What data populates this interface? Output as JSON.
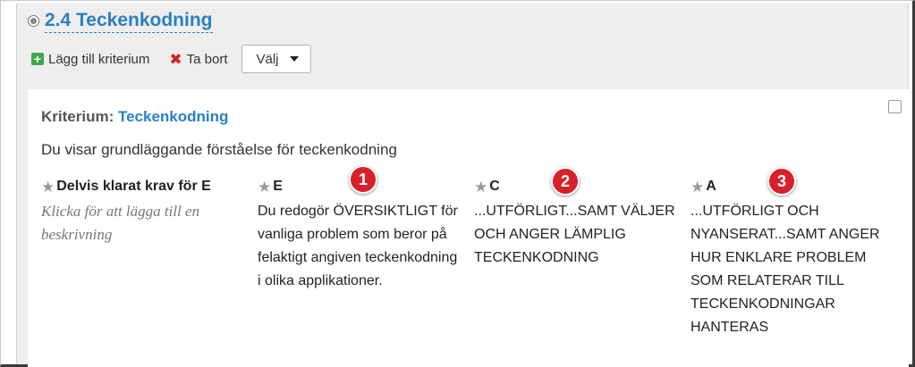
{
  "section": {
    "title": "2.4 Teckenkodning"
  },
  "toolbar": {
    "add_label": "Lägg till kriterium",
    "remove_label": "Ta bort",
    "select_label": "Välj"
  },
  "criterion": {
    "prefix": "Kriterium:",
    "name": "Teckenkodning",
    "description": "Du visar grundläggande förståelse för teckenkodning",
    "levels": [
      {
        "heading": "Delvis klarat krav för E",
        "text": "Klicka för att lägga till en beskrivning",
        "placeholder": true
      },
      {
        "heading": "E",
        "text": "Du redogör ÖVERSIKTLIGT för vanliga problem som beror på felaktigt angiven teckenkodning i olika applikationer.",
        "badge": "1"
      },
      {
        "heading": "C",
        "text": "...UTFÖRLIGT...SAMT VÄLJER OCH ANGER LÄMPLIG TECKENKODNING",
        "badge": "2"
      },
      {
        "heading": "A",
        "text": "...UTFÖRLIGT OCH NYANSERAT...SAMT ANGER HUR ENKLARE PROBLEM SOM RELATERAR TILL TECKENKODNINGAR HANTERAS",
        "badge": "3"
      }
    ]
  },
  "colors": {
    "link": "#2a7fc1",
    "badge": "#d8202a",
    "add_icon": "#3caa4a",
    "remove_icon": "#d42020"
  },
  "icons": {
    "section_marker": "radio-icon",
    "add": "plus-square-icon",
    "remove": "x-icon",
    "dropdown": "caret-down-icon",
    "level": "star-icon"
  }
}
